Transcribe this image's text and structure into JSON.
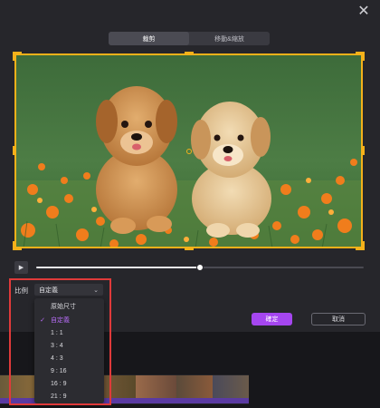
{
  "tabs": [
    {
      "label": "裁剪",
      "active": true
    },
    {
      "label": "移動&縮放",
      "active": false
    }
  ],
  "playback": {
    "progress": 0.5
  },
  "ratio": {
    "label": "比例",
    "selected": "自定義",
    "options": [
      "原始尺寸",
      "自定義",
      "1 : 1",
      "3 : 4",
      "4 : 3",
      "9 : 16",
      "16 : 9",
      "21 : 9"
    ],
    "selected_index": 1
  },
  "buttons": {
    "confirm": "確定",
    "cancel": "取消"
  },
  "icons": {
    "close": "close-icon",
    "play": "play-icon",
    "chevron": "chevron-down-icon",
    "check": "check-icon"
  },
  "colors": {
    "accent": "#a546f0",
    "crop_frame": "#f4b11a",
    "highlight": "#e03a3a"
  }
}
